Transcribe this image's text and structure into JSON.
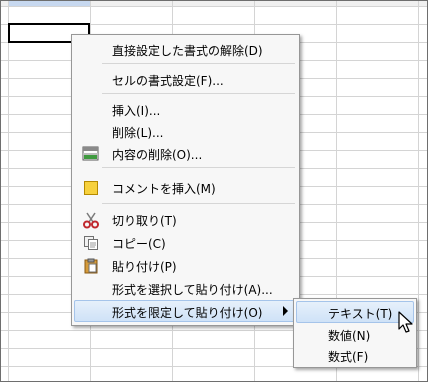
{
  "context_menu": {
    "items": [
      {
        "label": "直接設定した書式の解除(D)"
      },
      {
        "label": "セルの書式設定(F)..."
      },
      {
        "label": "挿入(I)..."
      },
      {
        "label": "削除(L)..."
      },
      {
        "label": "内容の削除(O)...",
        "icon": "clear-contents-icon"
      },
      {
        "label": "コメントを挿入(M)",
        "icon": "comment-icon"
      },
      {
        "label": "切り取り(T)",
        "icon": "scissors-icon"
      },
      {
        "label": "コピー(C)",
        "icon": "copy-icon"
      },
      {
        "label": "貼り付け(P)",
        "icon": "paste-icon"
      },
      {
        "label": "形式を選択して貼り付け(A)..."
      },
      {
        "label": "形式を限定して貼り付け(O)",
        "has_submenu": true,
        "highlighted": true
      }
    ]
  },
  "submenu": {
    "items": [
      {
        "label": "テキスト(T)",
        "highlighted": true
      },
      {
        "label": "数値(N)"
      },
      {
        "label": "数式(F)"
      }
    ]
  },
  "colors": {
    "highlight": "#cfe2f7",
    "grid_line": "#d4d4d4",
    "selection_border": "#000000"
  }
}
